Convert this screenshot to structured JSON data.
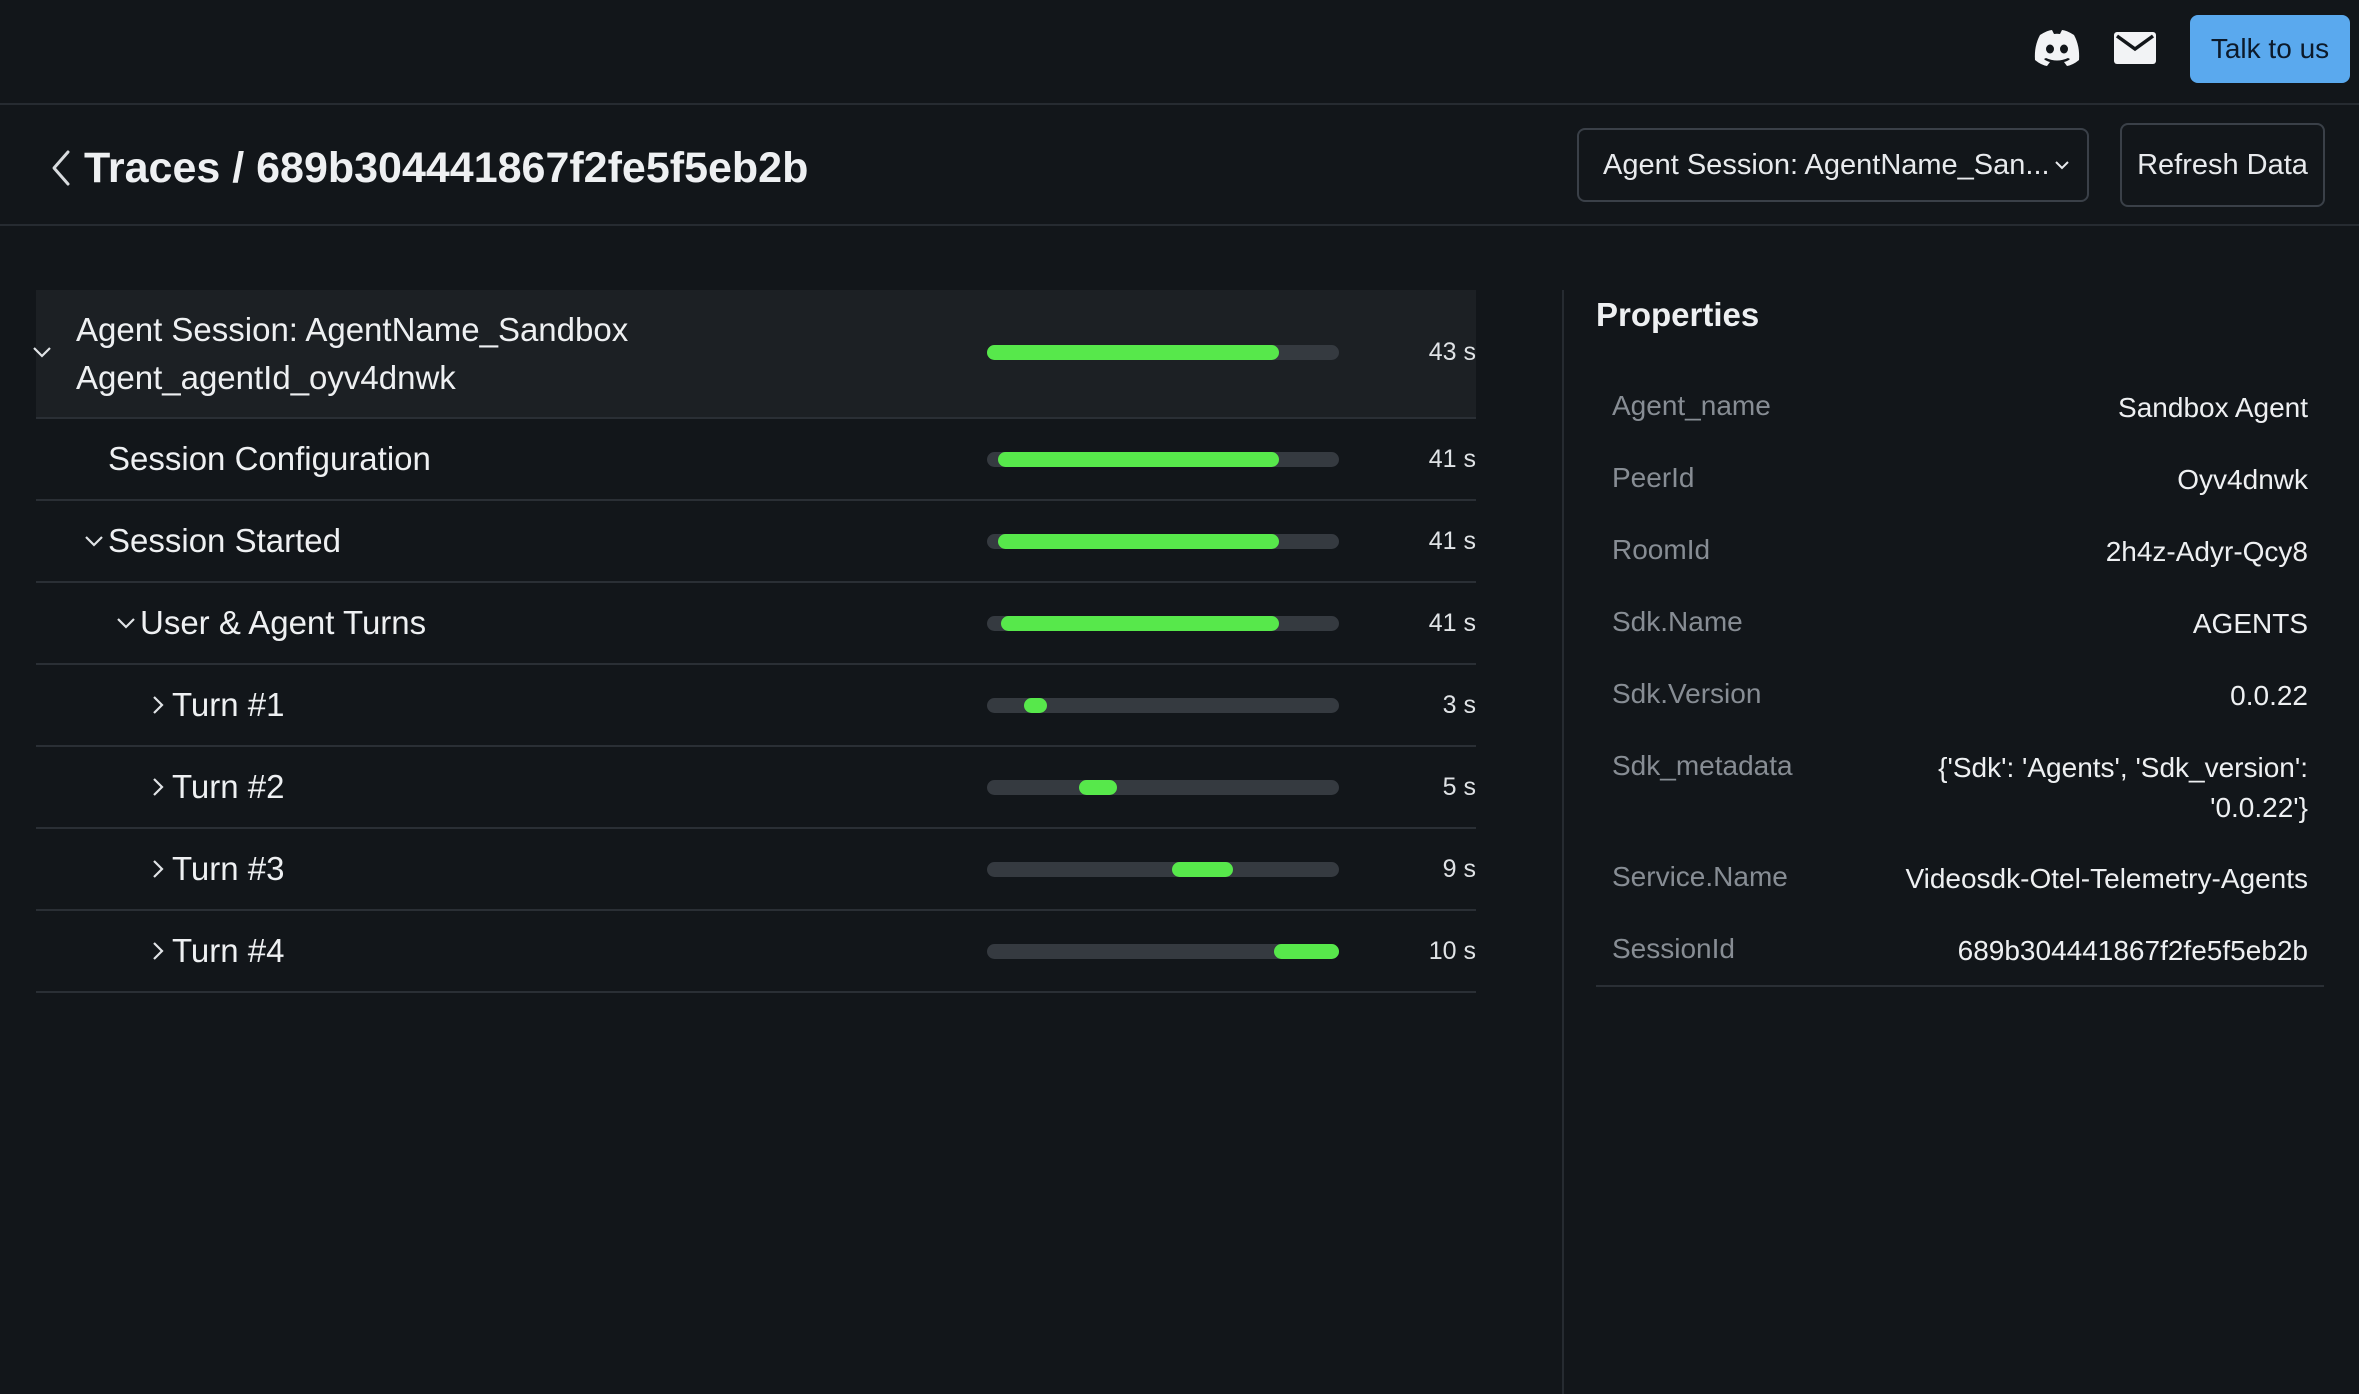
{
  "header": {
    "talk_label": "Talk to us",
    "discord_icon": "discord-icon",
    "mail_icon": "mail-icon"
  },
  "page": {
    "breadcrumb": "Traces / 689b304441867f2fe5f5eb2b",
    "session_select": "Agent Session: AgentName_San...",
    "refresh_label": "Refresh Data"
  },
  "colors": {
    "bar": "#57e84b",
    "track": "#353a40",
    "accent": "#5aa9ee"
  },
  "traces": [
    {
      "label": "Agent Session: AgentName_Sandbox",
      "label2": "Agent_agentId_oyv4dnwk",
      "duration": "43 s",
      "start_frac": 0.0,
      "end_frac": 0.83,
      "expanded": true,
      "depth": 0
    },
    {
      "label": "Session Configuration",
      "duration": "41 s",
      "start_frac": 0.03,
      "end_frac": 0.83,
      "depth": 1
    },
    {
      "label": "Session Started",
      "duration": "41 s",
      "start_frac": 0.03,
      "end_frac": 0.83,
      "expanded": true,
      "depth": 1
    },
    {
      "label": "User & Agent Turns",
      "duration": "41 s",
      "start_frac": 0.04,
      "end_frac": 0.83,
      "expanded": true,
      "depth": 2
    },
    {
      "label": "Turn #1",
      "duration": "3 s",
      "start_frac": 0.105,
      "end_frac": 0.17,
      "expanded": false,
      "depth": 3
    },
    {
      "label": "Turn #2",
      "duration": "5 s",
      "start_frac": 0.26,
      "end_frac": 0.37,
      "expanded": false,
      "depth": 3
    },
    {
      "label": "Turn #3",
      "duration": "9 s",
      "start_frac": 0.525,
      "end_frac": 0.7,
      "expanded": false,
      "depth": 3
    },
    {
      "label": "Turn #4",
      "duration": "10 s",
      "start_frac": 0.815,
      "end_frac": 1.0,
      "expanded": false,
      "depth": 3
    }
  ],
  "properties": {
    "title": "Properties",
    "items": [
      {
        "key": "Agent_name",
        "value": "Sandbox Agent"
      },
      {
        "key": "PeerId",
        "value": "Oyv4dnwk"
      },
      {
        "key": "RoomId",
        "value": "2h4z-Adyr-Qcy8"
      },
      {
        "key": "Sdk.Name",
        "value": "AGENTS"
      },
      {
        "key": "Sdk.Version",
        "value": "0.0.22"
      },
      {
        "key": "Sdk_metadata",
        "value": "{'Sdk': 'Agents', 'Sdk_version': '0.0.22'}"
      },
      {
        "key": "Service.Name",
        "value": "Videosdk-Otel-Telemetry-Agents"
      },
      {
        "key": "SessionId",
        "value": "689b304441867f2fe5f5eb2b"
      }
    ]
  }
}
